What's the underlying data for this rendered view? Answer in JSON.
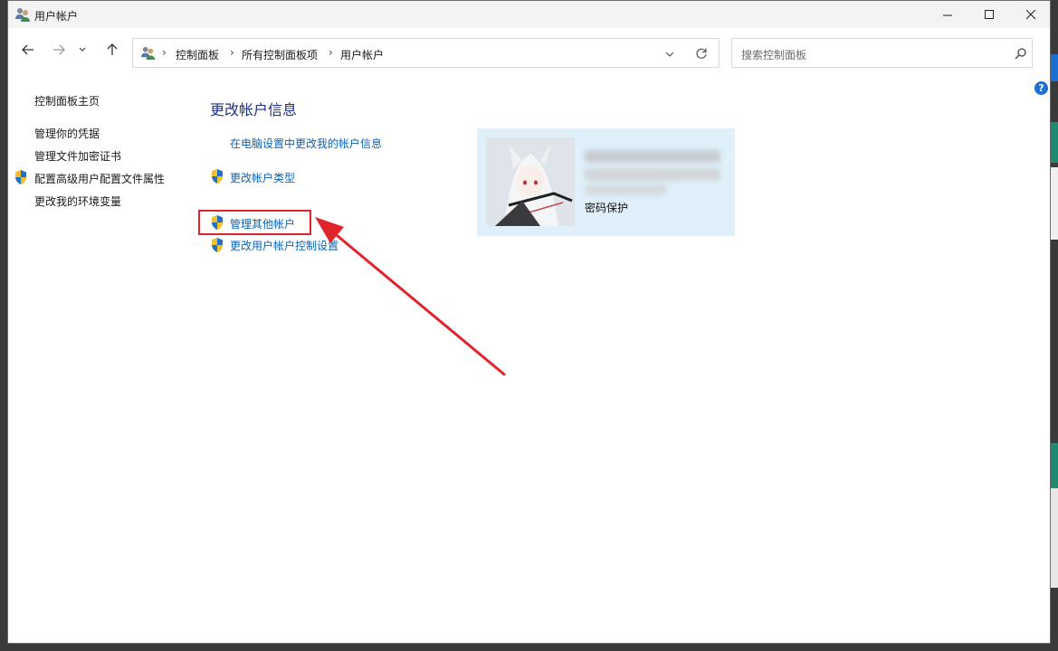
{
  "window": {
    "title": "用户帐户"
  },
  "address": {
    "breadcrumbs": [
      "控制面板",
      "所有控制面板项",
      "用户帐户"
    ]
  },
  "search": {
    "placeholder": "搜索控制面板"
  },
  "sidebar": {
    "home": "控制面板主页",
    "items": [
      "管理你的凭据",
      "管理文件加密证书",
      "配置高级用户配置文件属性",
      "更改我的环境变量"
    ]
  },
  "main": {
    "title": "更改帐户信息",
    "links": [
      "在电脑设置中更改我的帐户信息",
      "更改帐户类型",
      "管理其他帐户",
      "更改用户帐户控制设置"
    ]
  },
  "account_card": {
    "status": "密码保护"
  },
  "help": {
    "label": "?"
  },
  "colors": {
    "link": "#0b62b5",
    "title": "#1e3287",
    "highlight": "#e0242b",
    "card_bg": "#dff0fb"
  }
}
